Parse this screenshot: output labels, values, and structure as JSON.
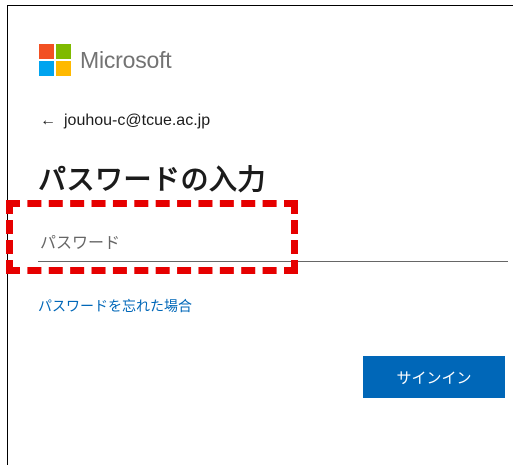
{
  "brand": {
    "name": "Microsoft",
    "logo_colors": [
      "#f25022",
      "#7fba00",
      "#00a4ef",
      "#ffb900"
    ]
  },
  "account": {
    "back_icon": "←",
    "email": "jouhou-c@tcue.ac.jp"
  },
  "page": {
    "title": "パスワードの入力"
  },
  "password_field": {
    "placeholder": "パスワード",
    "value": ""
  },
  "links": {
    "forgot_password": "パスワードを忘れた場合"
  },
  "buttons": {
    "sign_in": "サインイン"
  },
  "colors": {
    "accent": "#0067b8",
    "highlight": "#e60000"
  }
}
